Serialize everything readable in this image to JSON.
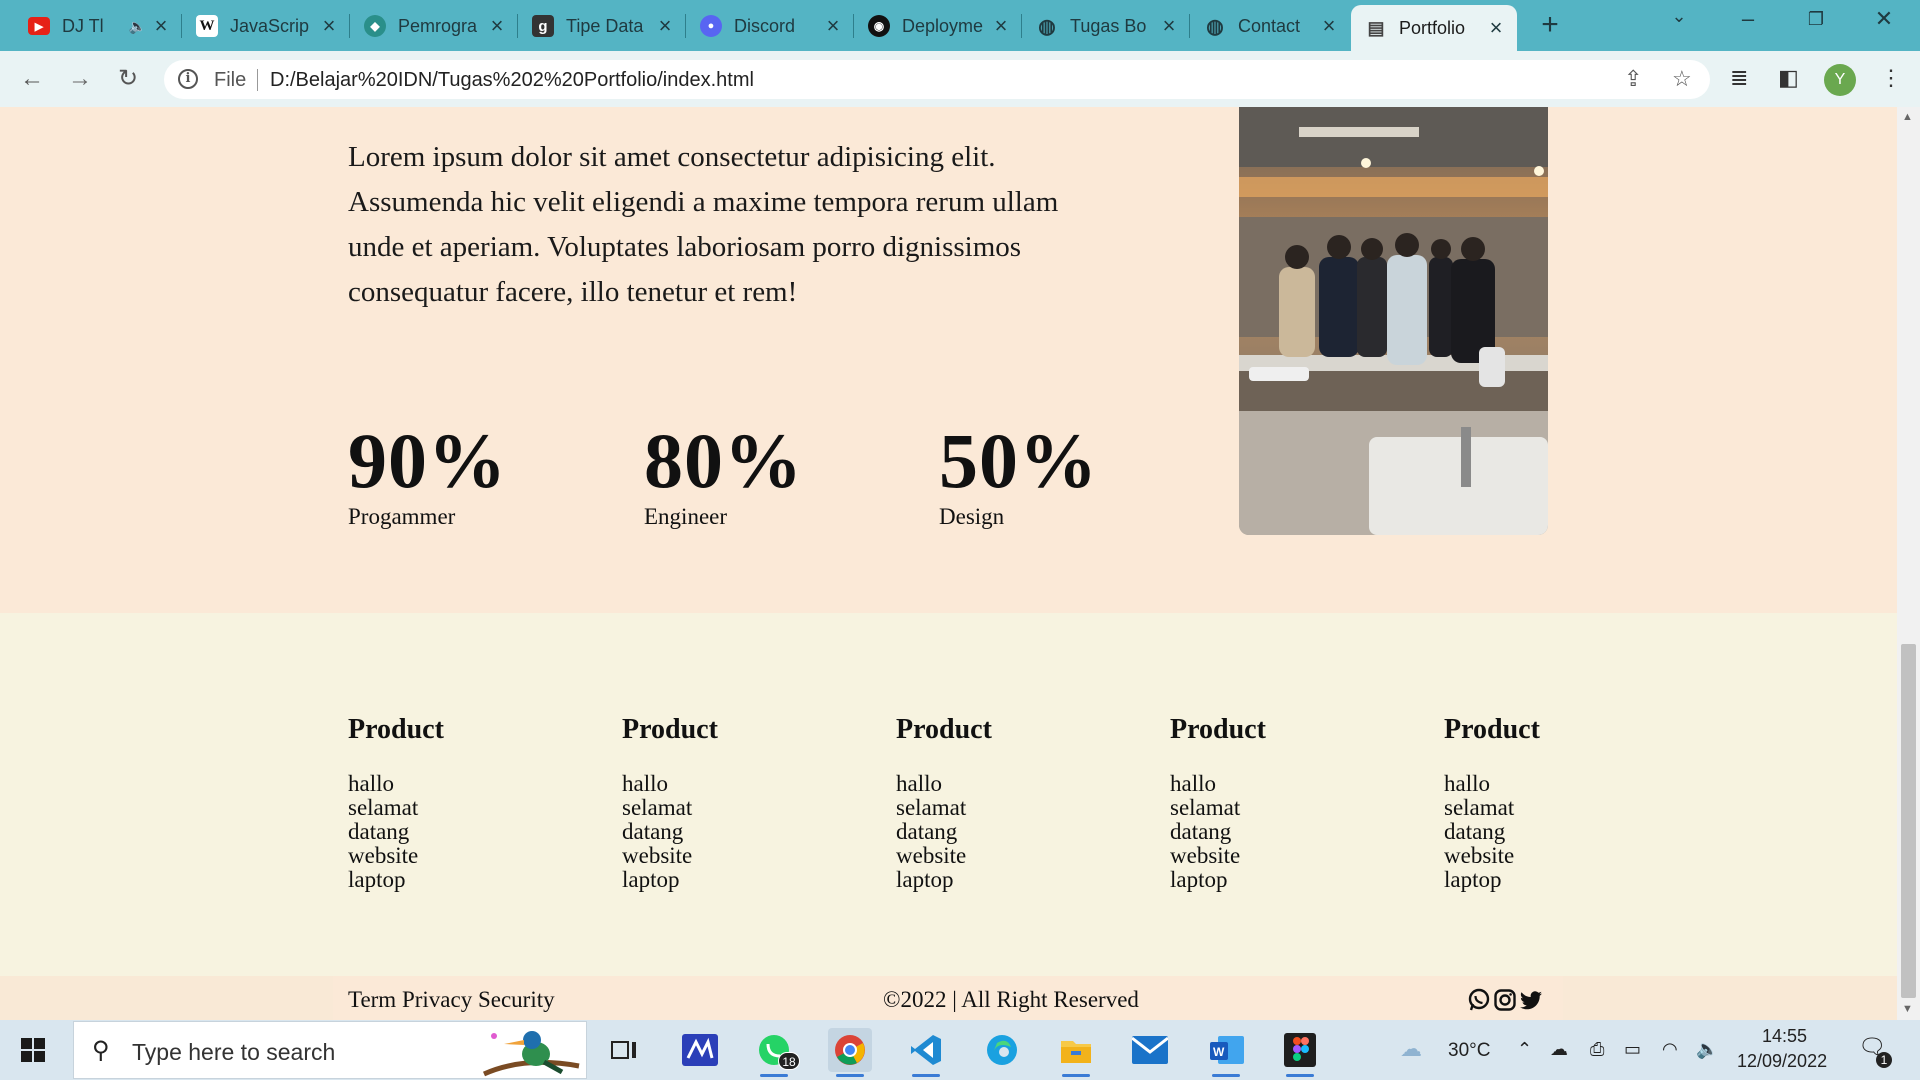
{
  "browser": {
    "tabs": [
      {
        "title": "DJ Tl",
        "favicon": "youtube-icon",
        "muted_icon": "speaker-icon"
      },
      {
        "title": "JavaScrip",
        "favicon": "wikipedia-icon"
      },
      {
        "title": "Pemrogra",
        "favicon": "site-icon"
      },
      {
        "title": "Tipe Data",
        "favicon": "g-site-icon"
      },
      {
        "title": "Discord",
        "favicon": "discord-icon"
      },
      {
        "title": "Deployme",
        "favicon": "github-icon"
      },
      {
        "title": "Tugas Bo",
        "favicon": "globe-icon"
      },
      {
        "title": "Contact",
        "favicon": "globe-icon"
      },
      {
        "title": "Portfolio",
        "favicon": "page-icon",
        "active": true
      }
    ],
    "new_tab_label": "+",
    "address": {
      "scheme_label": "File",
      "url": "D:/Belajar%20IDN/Tugas%202%20Portfolio/index.html"
    },
    "profile_initial": "Y"
  },
  "page": {
    "about_text": "Lorem ipsum dolor sit amet consectetur adipisicing elit. Assumenda hic velit eligendi a maxime tempora rerum ullam unde et aperiam. Voluptates laboriosam porro dignissimos consequatur facere, illo tenetur et rem!",
    "stats": [
      {
        "value": "90%",
        "label": "Progammer",
        "fraction": 0.9
      },
      {
        "value": "80%",
        "label": "Engineer",
        "fraction": 0.8
      },
      {
        "value": "50%",
        "label": "Design",
        "fraction": 0.5
      }
    ],
    "link_columns": [
      {
        "heading": "Product",
        "items": [
          "hallo",
          "selamat",
          "datang",
          "website",
          "laptop"
        ]
      },
      {
        "heading": "Product",
        "items": [
          "hallo",
          "selamat",
          "datang",
          "website",
          "laptop"
        ]
      },
      {
        "heading": "Product",
        "items": [
          "hallo",
          "selamat",
          "datang",
          "website",
          "laptop"
        ]
      },
      {
        "heading": "Product",
        "items": [
          "hallo",
          "selamat",
          "datang",
          "website",
          "laptop"
        ]
      },
      {
        "heading": "Product",
        "items": [
          "hallo",
          "selamat",
          "datang",
          "website",
          "laptop"
        ]
      }
    ],
    "footer": {
      "left": "Term Privacy Security",
      "center": "©2022 | All Right Reserved",
      "social_icons": [
        "whatsapp-icon",
        "instagram-icon",
        "twitter-icon"
      ]
    }
  },
  "taskbar": {
    "search_placeholder": "Type here to search",
    "whatsapp_badge": "18",
    "weather": "30°C",
    "time": "14:55",
    "date": "12/09/2022",
    "notification_count": "1"
  },
  "colors": {
    "tabstrip": "#54b4c4",
    "hero_bg": "#fbe9d7",
    "links_bg": "#f7f3e0"
  }
}
